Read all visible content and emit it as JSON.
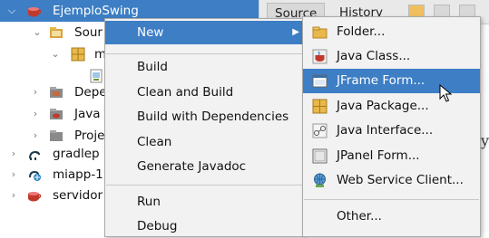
{
  "tree": {
    "rows": [
      {
        "label": "EjemploSwing",
        "icon": "java-project-icon"
      },
      {
        "label": "Sour",
        "icon": "source-package-icon"
      },
      {
        "label": "m",
        "icon": "package-icon"
      },
      {
        "label": "",
        "icon": "java-file-icon"
      },
      {
        "label": "Depe",
        "icon": "dependencies-icon"
      },
      {
        "label": "Java",
        "icon": "java-folder-icon"
      },
      {
        "label": "Proje",
        "icon": "project-files-icon"
      },
      {
        "label": "gradlep",
        "icon": "gradle-icon"
      },
      {
        "label": "miapp-1",
        "icon": "gradle-project-icon"
      },
      {
        "label": "servidor",
        "icon": "java-project-icon"
      }
    ]
  },
  "editor": {
    "tabs": [
      "Source",
      "History"
    ],
    "code_fragment": "oy"
  },
  "context_menu": {
    "items": [
      {
        "label": "New",
        "has_submenu": true
      },
      {
        "label": "Build"
      },
      {
        "label": "Clean and Build"
      },
      {
        "label": "Build with Dependencies"
      },
      {
        "label": "Clean"
      },
      {
        "label": "Generate Javadoc"
      },
      {
        "label": "Run"
      },
      {
        "label": "Debug"
      }
    ]
  },
  "submenu": {
    "items": [
      {
        "label": "Folder...",
        "icon": "folder-icon"
      },
      {
        "label": "Java Class...",
        "icon": "java-class-icon"
      },
      {
        "label": "JFrame Form...",
        "icon": "jframe-form-icon"
      },
      {
        "label": "Java Package...",
        "icon": "java-package-icon"
      },
      {
        "label": "Java Interface...",
        "icon": "java-interface-icon"
      },
      {
        "label": "JPanel Form...",
        "icon": "jpanel-form-icon"
      },
      {
        "label": "Web Service Client...",
        "icon": "web-service-client-icon"
      },
      {
        "label": "Other...",
        "icon": ""
      }
    ]
  },
  "colors": {
    "highlight": "#3d7ec4",
    "menu_bg": "#f2f2f2",
    "java_cup": "#c0392b",
    "folder": "#e8b84a"
  }
}
